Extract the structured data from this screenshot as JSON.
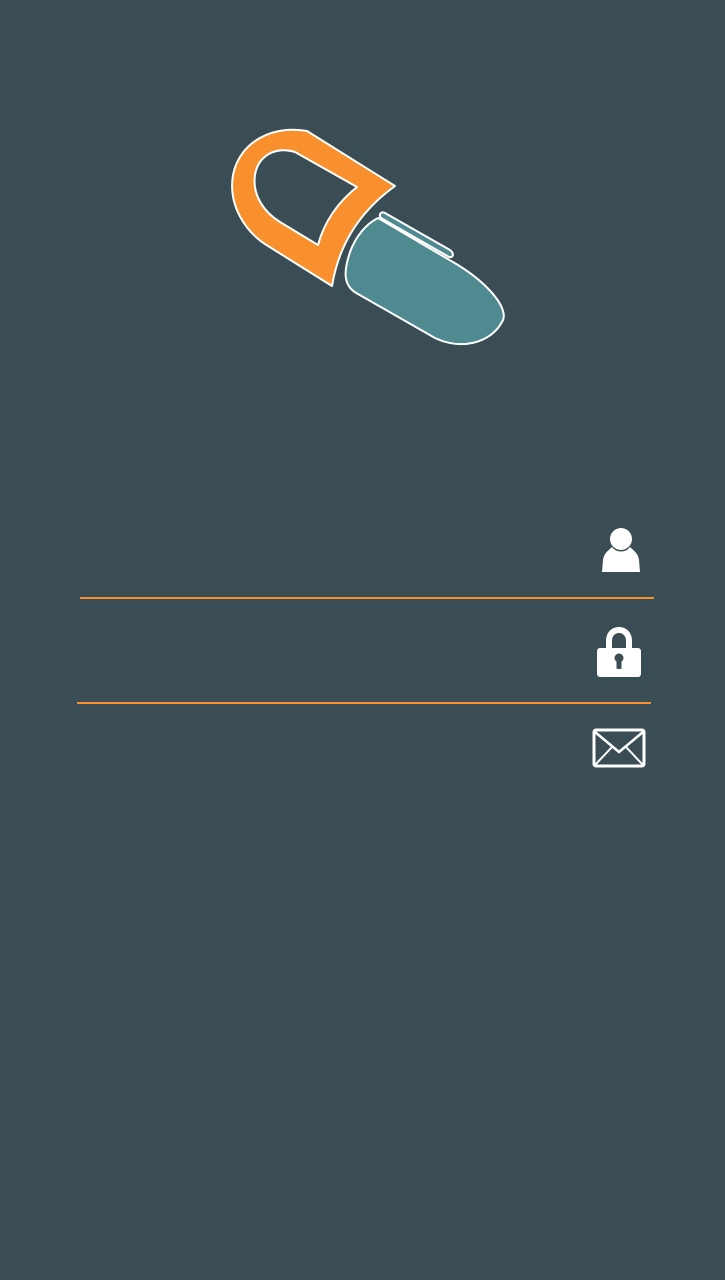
{
  "theme": {
    "background": "#3a4c54",
    "accent_orange": "#f7902d",
    "accent_teal": "#4f8a91",
    "icon_color": "#ffffff"
  },
  "logo": {
    "icon": "capsule-pill-icon"
  },
  "form": {
    "username": {
      "value": "",
      "placeholder": "",
      "icon": "user-icon"
    },
    "password": {
      "value": "",
      "placeholder": "",
      "icon": "lock-icon"
    },
    "email": {
      "value": "",
      "placeholder": "",
      "icon": "envelope-icon"
    }
  }
}
